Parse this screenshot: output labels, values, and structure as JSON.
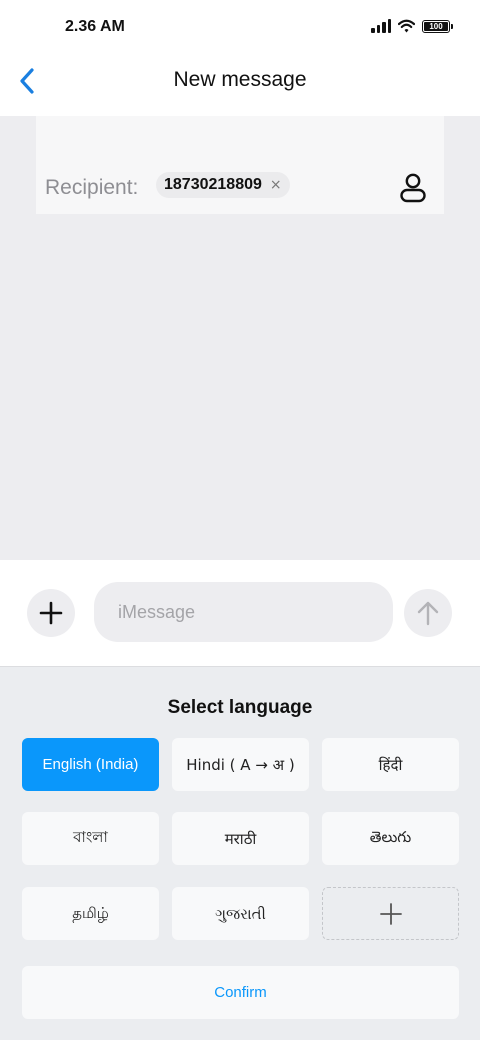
{
  "status_bar": {
    "time": "2.36 AM",
    "battery_level": "100",
    "icons": [
      "signal-icon",
      "wifi-icon",
      "battery-icon"
    ]
  },
  "header": {
    "title": "New message",
    "back_icon": "chevron-left-icon"
  },
  "recipient": {
    "label": "Recipient:",
    "chips": [
      {
        "number": "18730218809",
        "remove_glyph": "×"
      }
    ],
    "contact_icon": "person-icon"
  },
  "composer": {
    "add_icon": "plus-icon",
    "placeholder": "iMessage",
    "value": "",
    "send_icon": "arrow-up-icon"
  },
  "language_panel": {
    "title": "Select language",
    "languages": [
      {
        "label": "English (India)",
        "selected": true
      },
      {
        "label": "Hindi ( A → अ )",
        "selected": false
      },
      {
        "label": "हिंदी",
        "selected": false
      },
      {
        "label": "বাংলা",
        "selected": false
      },
      {
        "label": "मराठी",
        "selected": false
      },
      {
        "label": "తెలుగు",
        "selected": false
      },
      {
        "label": "தமிழ்",
        "selected": false
      },
      {
        "label": "ગુજરાતી",
        "selected": false
      }
    ],
    "add_icon": "plus-icon",
    "confirm_label": "Confirm"
  },
  "colors": {
    "accent": "#0a97fb",
    "back_arrow": "#1a7fe0",
    "conversation_bg": "#ededf0",
    "panel_bg": "#ebedf0"
  }
}
